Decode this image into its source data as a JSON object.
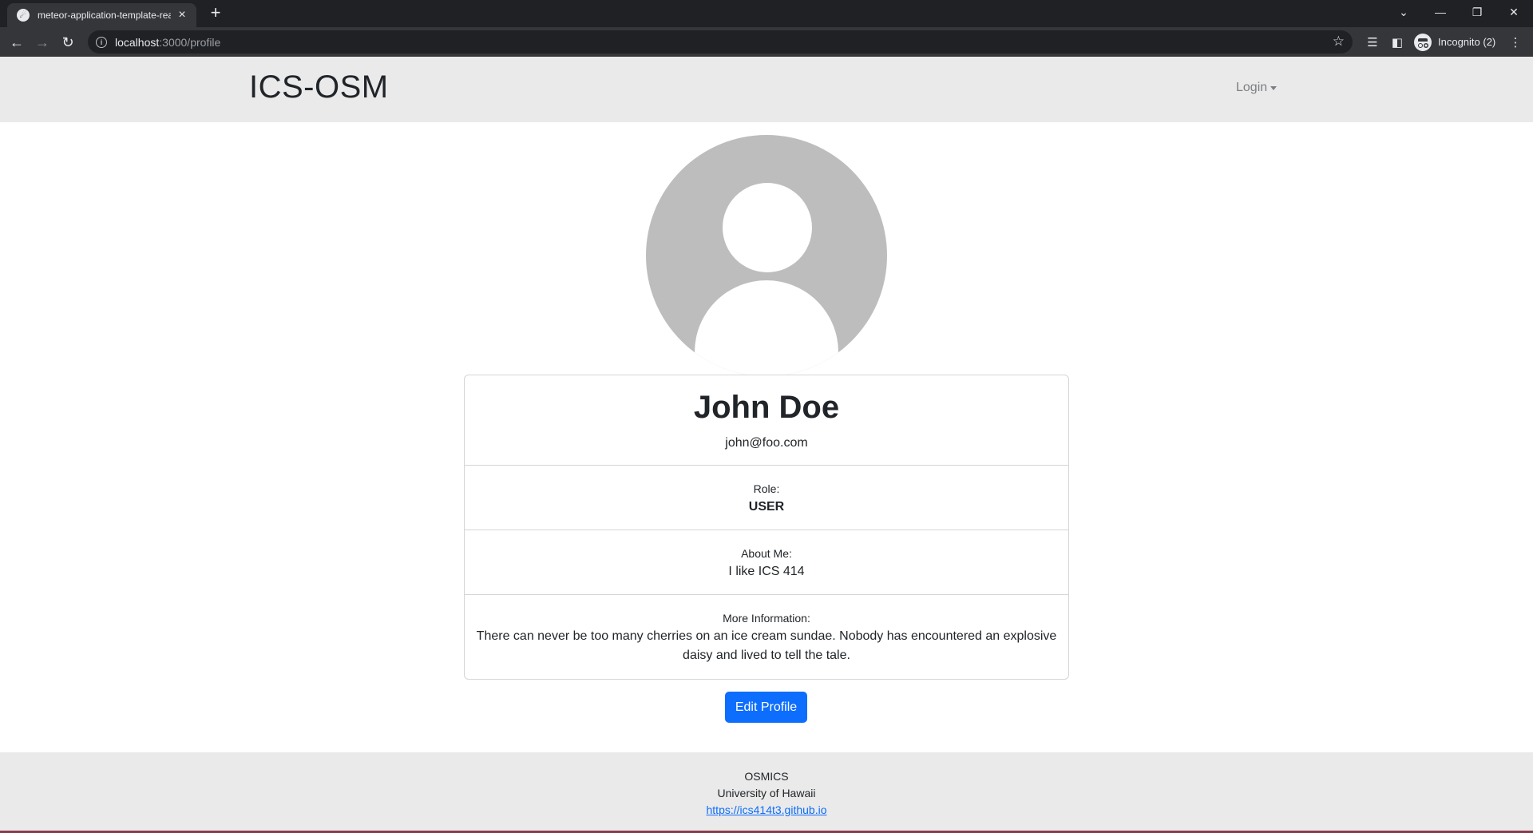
{
  "browser": {
    "tab_title": "meteor-application-template-rea",
    "url_host": "localhost",
    "url_path": ":3000/profile",
    "profile_label": "Incognito (2)",
    "colors": {
      "chrome_dark": "#202124",
      "chrome_toolbar": "#35363a"
    }
  },
  "navbar": {
    "brand": "ICS-OSM",
    "login_label": "Login",
    "background": "#eaeaea"
  },
  "profile": {
    "avatar_icon": "default-user-avatar-icon",
    "name": "John Doe",
    "email": "john@foo.com",
    "role_label": "Role:",
    "role_value": "USER",
    "about_label": "About Me:",
    "about_value": "I like ICS 414",
    "more_label": "More Information:",
    "more_value": "There can never be too many cherries on an ice cream sundae. Nobody has encountered an explosive daisy and lived to tell the tale."
  },
  "actions": {
    "edit_label": "Edit Profile",
    "button_color": "#0d6efd"
  },
  "footer": {
    "line1": "OSMICS",
    "line2": "University of Hawaii",
    "link": "https://ics414t3.github.io"
  }
}
